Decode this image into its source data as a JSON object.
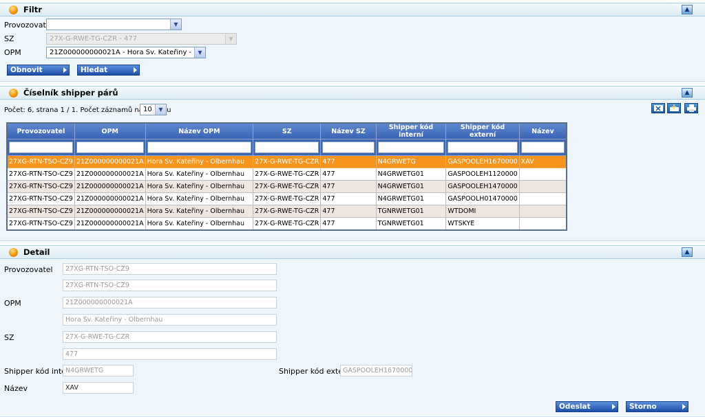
{
  "filter": {
    "title": "Filtr",
    "collapse_icon": "chevron-up-icon",
    "provozovatel_label": "Provozovatel",
    "provozovatel_value": "",
    "sz_label": "SZ",
    "sz_value": "27X-G-RWE-TG-CZR - 477",
    "opm_label": "OPM",
    "opm_value": "21Z000000000021A - Hora Sv. Kateřiny - Olbernhau",
    "refresh_label": "Obnovit",
    "search_label": "Hledat"
  },
  "list": {
    "title": "Číselník shipper párů",
    "pager_text": "Počet: 6, strana 1 / 1. Počet záznamů na stránku",
    "page_size": "10",
    "columns": [
      "Provozovatel",
      "OPM",
      "Název OPM",
      "SZ",
      "Název SZ",
      "Shipper kód interní",
      "Shipper kód externí",
      "Název"
    ],
    "rows": [
      [
        "27XG-RTN-TSO-CZ9",
        "21Z000000000021A",
        "Hora Sv. Kateřiny - Olbernhau",
        "27X-G-RWE-TG-CZR",
        "477",
        "N4GRWETG",
        "GASPOOLEH1670000",
        "XAV"
      ],
      [
        "27XG-RTN-TSO-CZ9",
        "21Z000000000021A",
        "Hora Sv. Kateřiny - Olbernhau",
        "27X-G-RWE-TG-CZR",
        "477",
        "N4GRWETG01",
        "GASPOOLEH1120000",
        ""
      ],
      [
        "27XG-RTN-TSO-CZ9",
        "21Z000000000021A",
        "Hora Sv. Kateřiny - Olbernhau",
        "27X-G-RWE-TG-CZR",
        "477",
        "N4GRWETG01",
        "GASPOOLEH1470000",
        ""
      ],
      [
        "27XG-RTN-TSO-CZ9",
        "21Z000000000021A",
        "Hora Sv. Kateřiny - Olbernhau",
        "27X-G-RWE-TG-CZR",
        "477",
        "N4GRWETG01",
        "GASPOOLH01470000",
        ""
      ],
      [
        "27XG-RTN-TSO-CZ9",
        "21Z000000000021A",
        "Hora Sv. Kateřiny - Olbernhau",
        "27X-G-RWE-TG-CZR",
        "477",
        "TGNRWETG01",
        "WTDOMI",
        ""
      ],
      [
        "27XG-RTN-TSO-CZ9",
        "21Z000000000021A",
        "Hora Sv. Kateřiny - Olbernhau",
        "27X-G-RWE-TG-CZR",
        "477",
        "TGNRWETG01",
        "WTSKYE",
        ""
      ]
    ],
    "selected_row": 0,
    "toolbar_icons": [
      "export-excel-icon",
      "import-icon",
      "print-icon"
    ]
  },
  "detail": {
    "title": "Detail",
    "provozovatel_label": "Provozovatel",
    "provozovatel_code": "27XG-RTN-TSO-CZ9",
    "provozovatel_name": "27XG-RTN-TSO-CZ9",
    "opm_label": "OPM",
    "opm_code": "21Z000000000021A",
    "opm_name": "Hora Sv. Kateřiny - Olbernhau",
    "sz_label": "SZ",
    "sz_code": "27X-G-RWE-TG-CZR",
    "sz_name": "477",
    "shipper_int_label": "Shipper kód interní",
    "shipper_int_value": "N4GRWETG",
    "shipper_ext_label": "Shipper kód externí",
    "shipper_ext_value": "GASPOOLEH1670000",
    "nazev_label": "Název",
    "nazev_value": "XAV",
    "submit_label": "Odeslat",
    "cancel_label": "Storno"
  },
  "colors": {
    "accent": "#3a63b5",
    "selected_row": "#f7941d",
    "section_bg": "#eef6fb"
  }
}
